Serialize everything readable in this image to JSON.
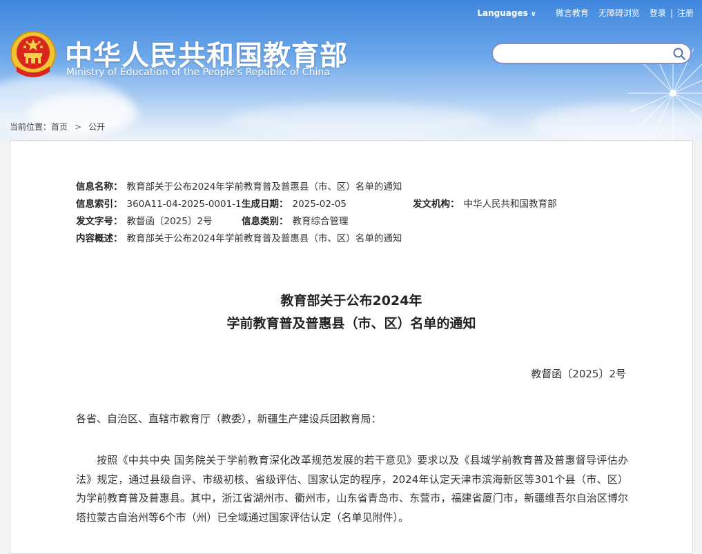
{
  "top_nav": {
    "languages": "Languages",
    "weibo": "微言教育",
    "accessibility": "无障碍浏览",
    "login": "登录",
    "separator": "|",
    "register": "注册"
  },
  "site": {
    "title_cn": "中华人民共和国教育部",
    "title_en": "Ministry of Education of the People's Republic of China"
  },
  "search": {
    "value": ""
  },
  "breadcrumb": {
    "label": "当前位置：",
    "home": "首页",
    "current": "公开"
  },
  "meta": {
    "info_name_label": "信息名称：",
    "info_name": "教育部关于公布2024年学前教育普及普惠县（市、区）名单的通知",
    "index_label": "信息索引：",
    "index": "360A11-04-2025-0001-1",
    "date_label": "生成日期：",
    "date": "2025-02-05",
    "org_label": "发文机构：",
    "org": "中华人民共和国教育部",
    "doc_no_label": "发文字号：",
    "doc_no": "教督函〔2025〕2号",
    "category_label": "信息类别：",
    "category": "教育综合管理",
    "summary_label": "内容概述：",
    "summary": "教育部关于公布2024年学前教育普及普惠县（市、区）名单的通知"
  },
  "article": {
    "title_line1": "教育部关于公布2024年",
    "title_line2": "学前教育普及普惠县（市、区）名单的通知",
    "doc_number": "教督函〔2025〕2号",
    "salutation": "各省、自治区、直辖市教育厅（教委），新疆生产建设兵团教育局：",
    "paragraph1": "按照《中共中央 国务院关于学前教育深化改革规范发展的若干意见》要求以及《县域学前教育普及普惠督导评估办法》规定，通过县级自评、市级初核、省级评估、国家认定的程序，2024年认定天津市滨海新区等301个县（市、区）为学前教育普及普惠县。其中，浙江省湖州市、衢州市，山东省青岛市、东营市，福建省厦门市，新疆维吾尔自治区博尔塔拉蒙古自治州等6个市（州）已全域通过国家评估认定（名单见附件）。"
  }
}
